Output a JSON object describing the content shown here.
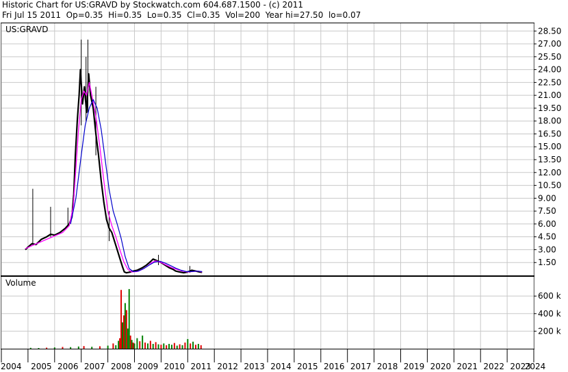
{
  "header": {
    "line1": "Historic Chart for US:GRAVD by Stockwatch.com 604.687.1500 - (c) 2011",
    "line2": "Fri Jul 15 2011  Op=0.35  Hi=0.35  Lo=0.35  Cl=0.35  Vol=200  Year hi=27.50  lo=0.07"
  },
  "colors": {
    "background": "#ffffff",
    "grid": "#c8c8c8",
    "price_bar": "#000000",
    "ma_short": "#ff00ff",
    "ma_long": "#0000cc",
    "volume_up": "#008000",
    "volume_down": "#dd0000"
  },
  "chart_data": [
    {
      "type": "line",
      "title": "US:GRAVD",
      "y_tick_labels": [
        "28.50",
        "27.00",
        "25.50",
        "24.00",
        "22.50",
        "21.00",
        "19.50",
        "18.00",
        "16.50",
        "15.00",
        "13.50",
        "12.00",
        "10.50",
        "9.00",
        "7.50",
        "6.00",
        "4.50",
        "3.00",
        "1.50"
      ],
      "ylim": [
        0,
        29.4
      ],
      "x_tick_labels": [
        "2004",
        "2005",
        "2006",
        "2007",
        "2008",
        "2009",
        "2010",
        "2011",
        "2012",
        "2013",
        "2014",
        "2015",
        "2016",
        "2017",
        "2018",
        "2019",
        "2020",
        "2021",
        "2022",
        "2023",
        "2024"
      ],
      "xlim": [
        2004.0,
        2024.0
      ],
      "grid": true,
      "series": [
        {
          "role": "price",
          "x": [
            2004.9,
            2005.0,
            2005.15,
            2005.3,
            2005.5,
            2005.7,
            2005.85,
            2006.0,
            2006.2,
            2006.4,
            2006.55,
            2006.65,
            2006.72,
            2006.78,
            2006.85,
            2006.92,
            2006.97,
            2007.05,
            2007.12,
            2007.2,
            2007.28,
            2007.35,
            2007.45,
            2007.55,
            2007.65,
            2007.75,
            2007.85,
            2007.95,
            2008.05,
            2008.15,
            2008.25,
            2008.35,
            2008.45,
            2008.55,
            2008.62,
            2008.7,
            2008.78,
            2008.85,
            2008.95,
            2009.1,
            2009.3,
            2009.45,
            2009.6,
            2009.7,
            2009.85,
            2010.0,
            2010.15,
            2010.3,
            2010.45,
            2010.55,
            2010.7,
            2010.85,
            2011.0,
            2011.15,
            2011.3,
            2011.45,
            2011.54
          ],
          "values": [
            3.0,
            3.3,
            3.7,
            3.6,
            4.2,
            4.5,
            4.8,
            4.7,
            5.0,
            5.5,
            6.0,
            6.8,
            9.5,
            14.0,
            18.0,
            21.0,
            24.0,
            20.0,
            22.0,
            19.0,
            23.5,
            21.0,
            19.5,
            16.5,
            14.0,
            11.0,
            8.5,
            6.5,
            5.5,
            5.0,
            4.0,
            3.0,
            2.0,
            1.0,
            0.4,
            0.3,
            0.35,
            0.4,
            0.5,
            0.6,
            0.9,
            1.2,
            1.6,
            1.9,
            1.7,
            1.5,
            1.2,
            0.9,
            0.7,
            0.5,
            0.4,
            0.3,
            0.4,
            0.6,
            0.5,
            0.4,
            0.35
          ]
        },
        {
          "role": "moving-average-short",
          "x": [
            2004.9,
            2005.1,
            2005.4,
            2005.7,
            2006.0,
            2006.3,
            2006.55,
            2006.7,
            2006.8,
            2006.9,
            2007.0,
            2007.1,
            2007.2,
            2007.3,
            2007.4,
            2007.55,
            2007.7,
            2007.85,
            2008.0,
            2008.15,
            2008.3,
            2008.45,
            2008.6,
            2008.75,
            2008.9,
            2009.1,
            2009.3,
            2009.5,
            2009.65,
            2009.8,
            2010.0,
            2010.2,
            2010.4,
            2010.6,
            2010.8,
            2011.0,
            2011.2,
            2011.4,
            2011.54
          ],
          "values": [
            3.1,
            3.4,
            3.8,
            4.2,
            4.6,
            5.0,
            5.8,
            8.0,
            12.5,
            17.0,
            20.5,
            21.5,
            21.0,
            22.5,
            21.0,
            18.5,
            15.0,
            11.0,
            7.5,
            5.8,
            4.5,
            3.0,
            1.6,
            0.7,
            0.4,
            0.45,
            0.7,
            1.1,
            1.5,
            1.7,
            1.5,
            1.2,
            0.9,
            0.7,
            0.5,
            0.4,
            0.45,
            0.5,
            0.4
          ]
        },
        {
          "role": "moving-average-long",
          "x": [
            2006.6,
            2006.8,
            2007.0,
            2007.15,
            2007.3,
            2007.45,
            2007.6,
            2007.75,
            2007.9,
            2008.05,
            2008.2,
            2008.35,
            2008.5,
            2008.65,
            2008.8,
            2008.95,
            2009.15,
            2009.35,
            2009.55,
            2009.75,
            2009.95,
            2010.15,
            2010.35,
            2010.55,
            2010.75,
            2010.95,
            2011.15,
            2011.35,
            2011.54
          ],
          "values": [
            6.0,
            9.0,
            14.0,
            17.5,
            19.5,
            20.5,
            19.5,
            17.0,
            13.5,
            10.0,
            7.5,
            6.0,
            4.3,
            2.2,
            0.8,
            0.45,
            0.5,
            0.8,
            1.2,
            1.55,
            1.65,
            1.45,
            1.15,
            0.85,
            0.6,
            0.45,
            0.45,
            0.5,
            0.45
          ]
        }
      ],
      "spikes": [
        {
          "x": 2005.18,
          "high": 10.1,
          "low": 3.5
        },
        {
          "x": 2005.85,
          "high": 8.0,
          "low": 4.5
        },
        {
          "x": 2006.5,
          "high": 7.9,
          "low": 5.8
        },
        {
          "x": 2007.0,
          "high": 27.5,
          "low": 17.5
        },
        {
          "x": 2007.18,
          "high": 25.5,
          "low": 18.0
        },
        {
          "x": 2007.25,
          "high": 27.5,
          "low": 19.0
        },
        {
          "x": 2007.55,
          "high": 22.0,
          "low": 14.0
        },
        {
          "x": 2008.05,
          "high": 7.5,
          "low": 4.0
        },
        {
          "x": 2009.9,
          "high": 2.4,
          "low": 1.2
        },
        {
          "x": 2011.08,
          "high": 1.1,
          "low": 0.3
        }
      ]
    },
    {
      "type": "bar",
      "title": "Volume",
      "y_tick_labels": [
        "600 k",
        "400 k",
        "200 k"
      ],
      "ylim": [
        0,
        820000
      ],
      "xlim": [
        2004.0,
        2024.0
      ],
      "x": [
        2005.1,
        2005.4,
        2005.7,
        2006.0,
        2006.3,
        2006.6,
        2006.9,
        2007.1,
        2007.4,
        2007.7,
        2008.0,
        2008.2,
        2008.3,
        2008.4,
        2008.45,
        2008.5,
        2008.55,
        2008.6,
        2008.65,
        2008.7,
        2008.75,
        2008.8,
        2008.85,
        2008.9,
        2008.95,
        2009.0,
        2009.1,
        2009.2,
        2009.3,
        2009.4,
        2009.5,
        2009.6,
        2009.7,
        2009.8,
        2009.9,
        2010.0,
        2010.1,
        2010.2,
        2010.3,
        2010.4,
        2010.5,
        2010.6,
        2010.7,
        2010.8,
        2010.9,
        2011.0,
        2011.1,
        2011.2,
        2011.3,
        2011.4,
        2011.5
      ],
      "values": [
        10000,
        8000,
        12000,
        15000,
        20000,
        18000,
        25000,
        30000,
        22000,
        28000,
        35000,
        60000,
        40000,
        90000,
        120000,
        670000,
        300000,
        380000,
        520000,
        440000,
        230000,
        680000,
        150000,
        100000,
        70000,
        60000,
        120000,
        85000,
        150000,
        70000,
        60000,
        90000,
        55000,
        75000,
        50000,
        45000,
        60000,
        40000,
        55000,
        45000,
        65000,
        35000,
        50000,
        40000,
        70000,
        110000,
        60000,
        80000,
        45000,
        55000,
        40000
      ],
      "direction": [
        "up",
        "up",
        "down",
        "up",
        "down",
        "up",
        "up",
        "down",
        "up",
        "down",
        "up",
        "down",
        "up",
        "up",
        "down",
        "down",
        "up",
        "down",
        "up",
        "down",
        "up",
        "up",
        "down",
        "up",
        "down",
        "up",
        "up",
        "down",
        "up",
        "down",
        "up",
        "down",
        "up",
        "down",
        "up",
        "down",
        "up",
        "down",
        "up",
        "up",
        "down",
        "up",
        "down",
        "up",
        "down",
        "up",
        "down",
        "up",
        "down",
        "up",
        "down"
      ]
    }
  ]
}
